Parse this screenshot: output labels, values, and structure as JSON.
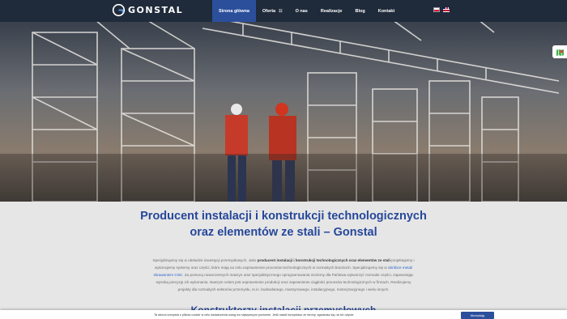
{
  "brand": {
    "name": "GONSTAL"
  },
  "nav": {
    "items": [
      {
        "label": "Strona główna",
        "active": true
      },
      {
        "label": "Oferta",
        "has_dropdown": true
      },
      {
        "label": "O nas"
      },
      {
        "label": "Realizacje"
      },
      {
        "label": "Blog"
      },
      {
        "label": "Kontakt"
      }
    ]
  },
  "languages": [
    {
      "code": "pl",
      "icon": "flag-pl-icon"
    },
    {
      "code": "en",
      "icon": "flag-en-icon"
    }
  ],
  "side_widget": {
    "icon": "map-widget-icon"
  },
  "hero": {
    "image": "construction-workers-steel-scaffolding"
  },
  "main": {
    "headline": "Producent instalacji i konstrukcji technologicznych oraz elementów ze stali – Gonstal",
    "intro": {
      "p1": "Specjalizujemy się w obsłudze inwestycji przemysłowych. Jako",
      "p1_bold": "producent instalacji i konstrukcji technologicznych oraz elementów ze stali",
      "p2": "projektujemy i wykonujemy systemy oraz części, które mają na celu usprawnienie procesów technologicznych w rozmaitych branżach. Specjalizujemy się w",
      "link": "obróbce metali skrawaniem CNC",
      "p3": ". Za pomocą nowoczesnych maszyn oraz specjalistycznego oprogramowania możemy dla Państwa wytworzyć rozmaite części, zapewniając wysoką precyzję ich wykonania. Naszym celem jest usprawnienie produkcji oraz zapewnienie ciągłości procesów technologicznych w firmach. Realizujemy projekty dla rozmaitych sektorów przemysłu, m.in. budowlanego, maszynowego, instalacyjnego, motoryzacyjnego i wielu innych."
    },
    "subheading": "Konstruktorzy instalacji przemysłowych"
  },
  "cookie": {
    "text": "Ta strona korzysta z plików cookie w celu świadczenia usług na najwyższym poziomie. Jeśli nadal korzystasz ze strony, zgadzasz się na ich użycie.",
    "button": "Akceptuję"
  },
  "colors": {
    "nav_bg": "#1f2a3a",
    "accent": "#2c4f9c",
    "headline": "#26479a"
  }
}
